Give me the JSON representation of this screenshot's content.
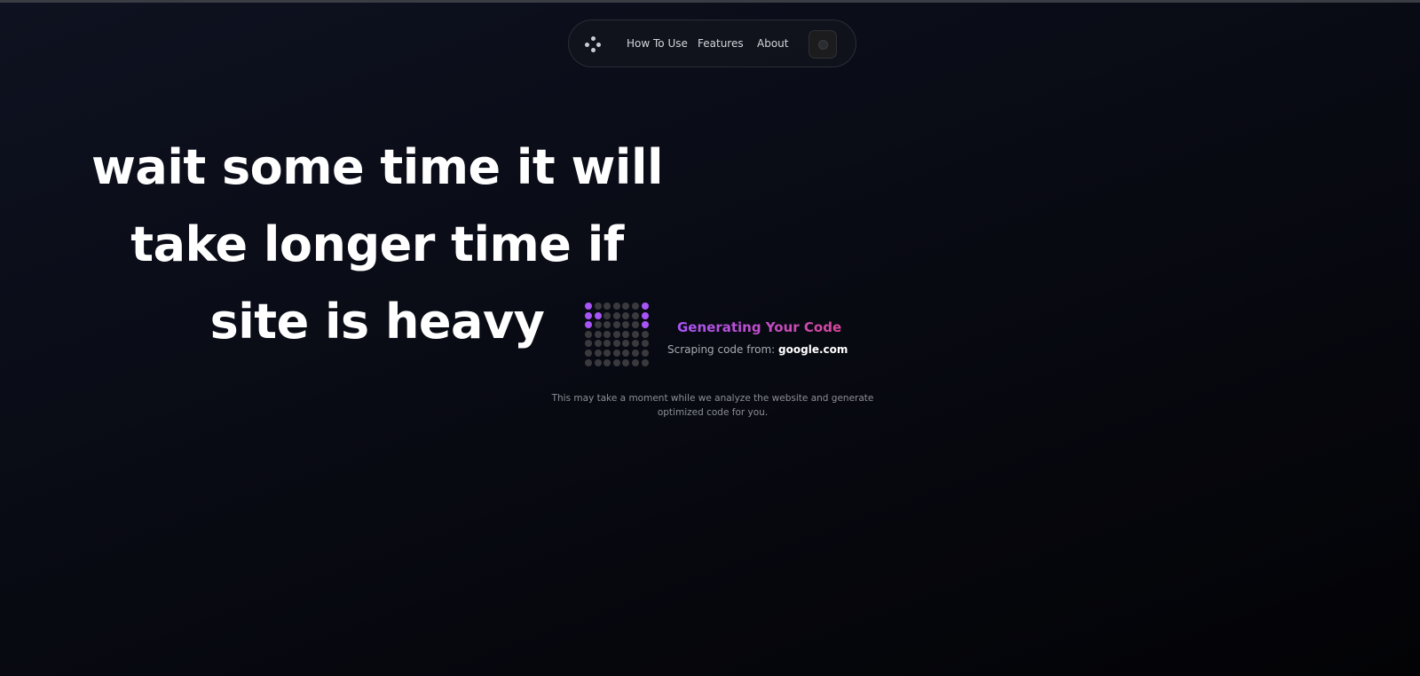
{
  "nav": {
    "logo_icon": "four-dots-logo-icon",
    "links": [
      "How To Use",
      "Features",
      "About"
    ],
    "theme_toggle_icon": "moon-icon"
  },
  "hero": {
    "message": "wait some time it will take longer time if site is heavy"
  },
  "loader": {
    "grid_icon": "dot-matrix-loader-icon",
    "accent_color": "#a855f7",
    "title": "Generating Your Code",
    "scrape_prefix": "Scraping code from:",
    "scrape_domain": "google.com",
    "note": "This may take a moment while we analyze the website and generate optimized code for you."
  }
}
